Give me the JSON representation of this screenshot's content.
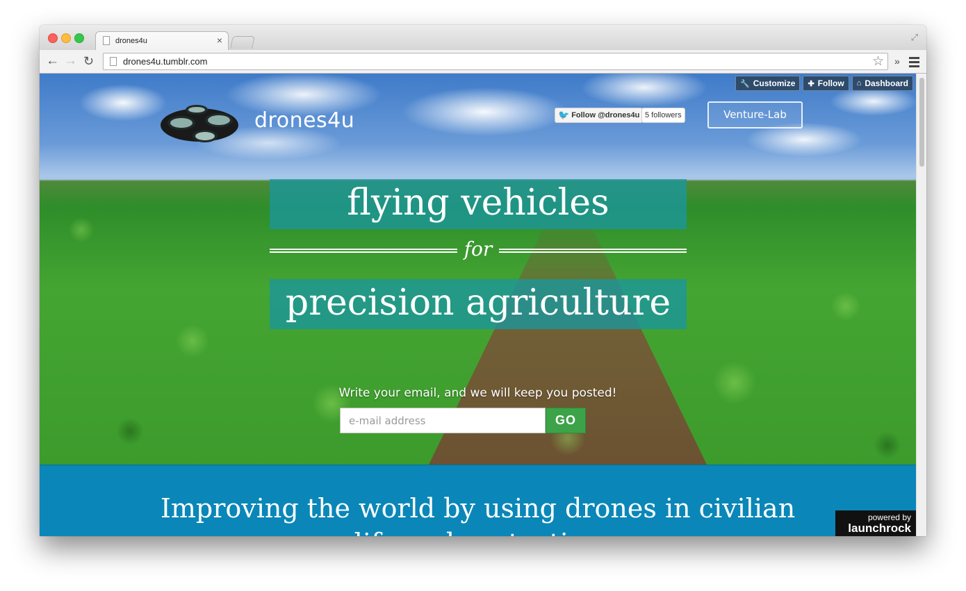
{
  "browser": {
    "tab_title": "drones4u",
    "url": "drones4u.tumblr.com"
  },
  "tumblr_controls": {
    "customize": "Customize",
    "follow": "Follow",
    "dashboard": "Dashboard"
  },
  "header": {
    "site_name": "drones4u",
    "twitter_follow": "Follow @drones4u",
    "followers": "5 followers",
    "venture_button": "Venture-Lab"
  },
  "hero": {
    "line1": "flying vehicles",
    "connector": "for",
    "line2": "precision agriculture",
    "signup_prompt": "Write your email, and we will keep you posted!",
    "email_placeholder": "e-mail address",
    "go_label": "GO"
  },
  "section": {
    "tagline": "Improving the world by using drones in civilian",
    "tagline_cont": "life and protection"
  },
  "badge": {
    "powered_by": "powered by",
    "brand": "launchrock"
  },
  "colors": {
    "hero_band": "#1b969b",
    "go_button": "#3da348",
    "blue_section": "#0a87b8"
  }
}
